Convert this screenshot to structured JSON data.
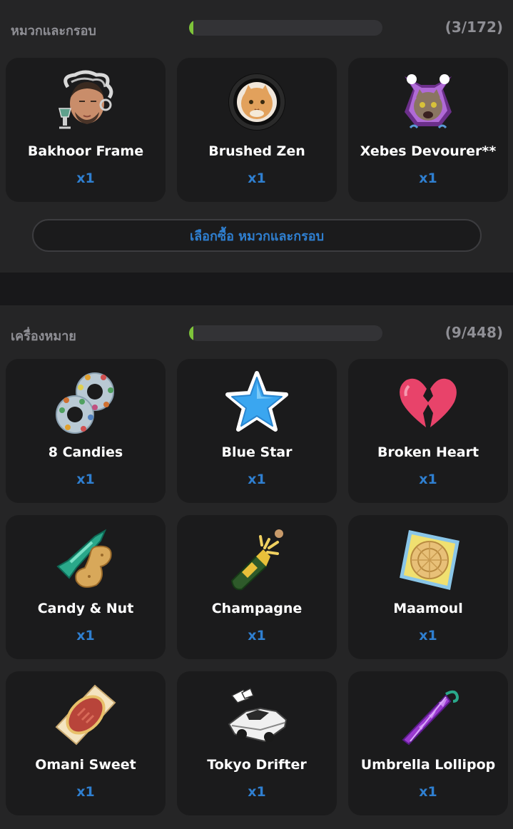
{
  "frames_section": {
    "title": "หมวกและกรอบ",
    "count_label": "(3/172)",
    "progress_fraction": 0.0174,
    "buy_button_label": "เลือกซื้อ หมวกและกรอบ",
    "items": [
      {
        "name": "Bakhoor Frame",
        "qty": "x1",
        "icon": "bakhoor-frame-icon"
      },
      {
        "name": "Brushed Zen",
        "qty": "x1",
        "icon": "brushed-zen-frame-icon"
      },
      {
        "name": "Xebes Devourer**",
        "qty": "x1",
        "icon": "xebes-devourer-frame-icon"
      }
    ]
  },
  "items_section": {
    "title": "เครื่องหมาย",
    "count_label": "(9/448)",
    "progress_fraction": 0.0201,
    "items": [
      {
        "name": "8 Candies",
        "qty": "x1",
        "icon": "candies-icon"
      },
      {
        "name": "Blue Star",
        "qty": "x1",
        "icon": "blue-star-icon"
      },
      {
        "name": "Broken Heart",
        "qty": "x1",
        "icon": "broken-heart-icon"
      },
      {
        "name": "Candy & Nut",
        "qty": "x1",
        "icon": "candy-nut-icon"
      },
      {
        "name": "Champagne",
        "qty": "x1",
        "icon": "champagne-icon"
      },
      {
        "name": "Maamoul",
        "qty": "x1",
        "icon": "maamoul-icon"
      },
      {
        "name": "Omani Sweet",
        "qty": "x1",
        "icon": "omani-sweet-icon"
      },
      {
        "name": "Tokyo Drifter",
        "qty": "x1",
        "icon": "tokyo-drifter-car-icon"
      },
      {
        "name": "Umbrella Lollipop",
        "qty": "x1",
        "icon": "umbrella-lollipop-icon"
      }
    ]
  },
  "colors": {
    "accent_blue": "#2f7fd0",
    "progress_green": "#7ec43a",
    "header_grey": "#8f8f95"
  }
}
